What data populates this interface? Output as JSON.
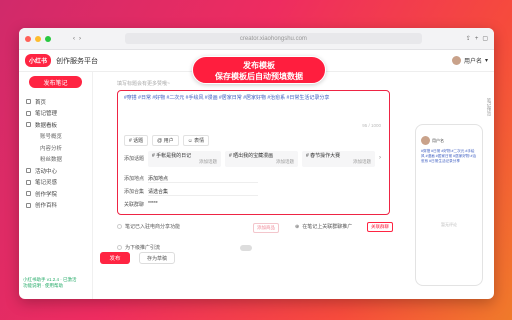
{
  "browser": {
    "address": "creator.xiaohongshu.com"
  },
  "app": {
    "logo": "小红书",
    "title": "创作服务平台",
    "user": "用户名"
  },
  "sidebar": {
    "publish": "发布笔记",
    "items": [
      {
        "label": "首页",
        "sub": false
      },
      {
        "label": "笔记管理",
        "sub": false
      },
      {
        "label": "数据看板",
        "sub": false
      },
      {
        "label": "账号概览",
        "sub": true
      },
      {
        "label": "内容分析",
        "sub": true
      },
      {
        "label": "粉丝数据",
        "sub": true
      },
      {
        "label": "活动中心",
        "sub": false
      },
      {
        "label": "笔记灵感",
        "sub": false
      },
      {
        "label": "创作学院",
        "sub": false
      },
      {
        "label": "创作百科",
        "sub": false
      }
    ],
    "version": "小红书助手 v1.2.4 · 已激活",
    "version2": "功能说明 · 使用帮助"
  },
  "banner": {
    "line1": "发布模板",
    "line2": "保存模板后自动预填数据"
  },
  "editor": {
    "placeholder": "填写标题会有更多赞哦~",
    "tags": "#穿搭 #日常 #好物 #二次元 #手绘风 #漫画 #居家日常 #居家好物 #治愈系 #日常生活记录分享",
    "counter": "95 / 1000",
    "toolbar": [
      "# 话题",
      "@ 用户",
      "☺ 表情"
    ],
    "topic_label": "添加话题",
    "topics": [
      {
        "title": "# 手帐是我的日记",
        "meta": "添加话题"
      },
      {
        "title": "# 晒出我的宝藏漫画",
        "meta": "添加话题"
      },
      {
        "title": "# 春节操作大赛",
        "meta": "添加话题"
      }
    ],
    "location_label": "添加地点",
    "location_value": "添加地点",
    "collection_label": "添加合集",
    "collection_value": "请选合集",
    "relate_label": "关联群聊",
    "relate_value": "*****"
  },
  "options": {
    "opt1": "笔记已入驻电商分享功能",
    "opt1_btn": "添加商品",
    "opt1_right": "在笔记上关联群聊推广",
    "opt1_right_btn": "关联群聊",
    "opt2": "为下级推广引流"
  },
  "footer": {
    "publish": "发布",
    "draft": "存为草稿"
  },
  "preview": {
    "label": "笔记预览",
    "empty": "暂无评论"
  }
}
